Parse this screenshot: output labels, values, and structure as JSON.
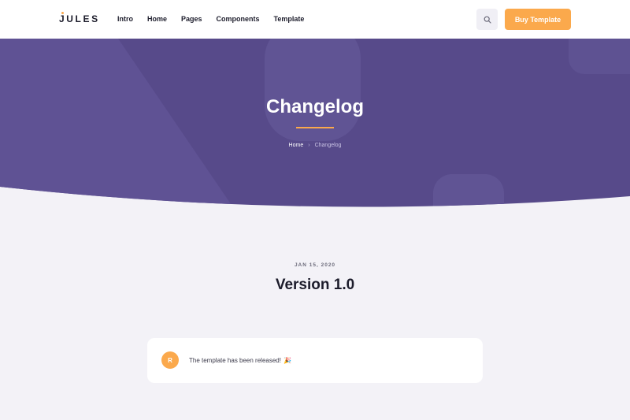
{
  "header": {
    "logo": "JULES",
    "nav": [
      "Intro",
      "Home",
      "Pages",
      "Components",
      "Template"
    ],
    "search_icon": "search-icon",
    "buy_label": "Buy Template"
  },
  "hero": {
    "title": "Changelog",
    "breadcrumb": {
      "home": "Home",
      "separator_icon": "chevron-right-icon",
      "current": "Changelog"
    }
  },
  "release": {
    "date": "JAN 15, 2020",
    "version": "Version 1.0",
    "entries": [
      {
        "avatar": "R",
        "text": "The template has been released!",
        "icon": "party-popper-icon"
      }
    ]
  },
  "colors": {
    "brand_purple": "#574a8a",
    "accent_orange": "#fba94c",
    "page_background": "#f3f2f7"
  }
}
